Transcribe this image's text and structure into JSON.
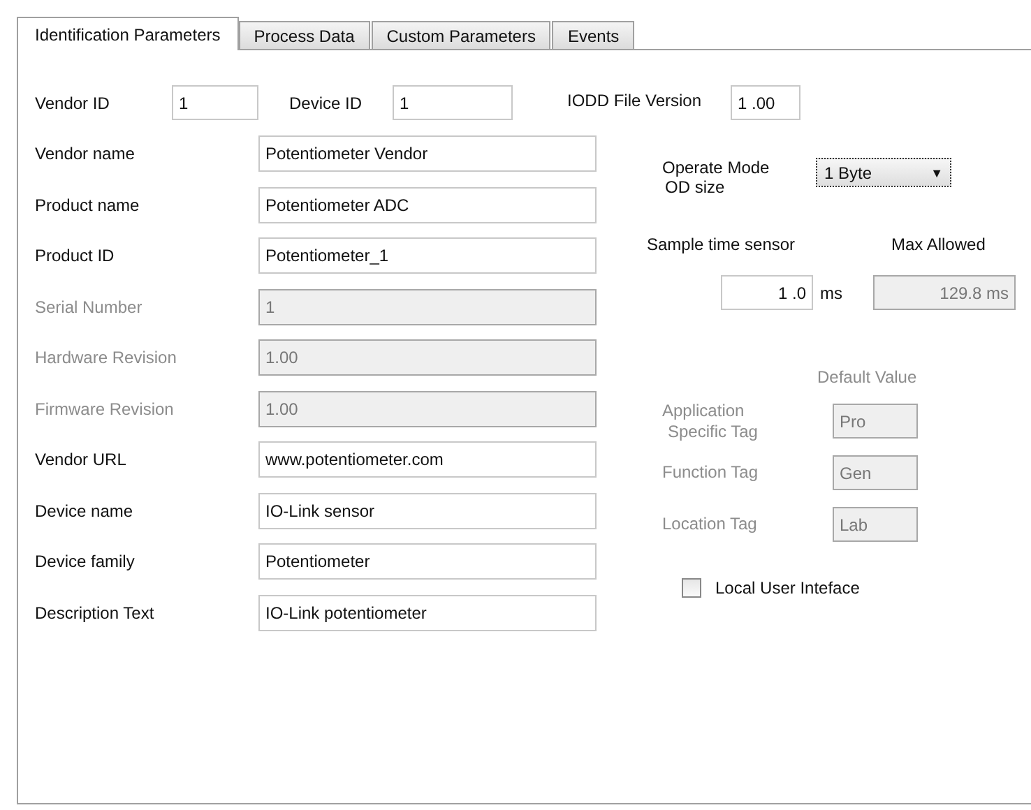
{
  "tabs": [
    {
      "label": "Identification Parameters",
      "selected": true
    },
    {
      "label": "Process Data",
      "selected": false
    },
    {
      "label": "Custom Parameters",
      "selected": false
    },
    {
      "label": "Events",
      "selected": false
    }
  ],
  "top_fields": [
    {
      "label": "Vendor ID",
      "value": "1"
    },
    {
      "label": "Device ID",
      "value": "1"
    },
    {
      "label": "IODD File Version",
      "value": "1 .00"
    }
  ],
  "fields": [
    {
      "label": "Vendor name",
      "value": "Potentiometer Vendor",
      "disabled": false
    },
    {
      "label": "Product name",
      "value": "Potentiometer ADC",
      "disabled": false
    },
    {
      "label": "Product ID",
      "value": "Potentiometer_1",
      "disabled": false
    },
    {
      "label": "Serial Number",
      "value": "1",
      "disabled": true
    },
    {
      "label": "Hardware Revision",
      "value": "1.00",
      "disabled": true
    },
    {
      "label": "Firmware Revision",
      "value": "1.00",
      "disabled": true
    },
    {
      "label": "Vendor URL",
      "value": "www.potentiometer.com",
      "disabled": false
    },
    {
      "label": "Device name",
      "value": "IO-Link sensor",
      "disabled": false
    },
    {
      "label": "Device family",
      "value": "Potentiometer",
      "disabled": false
    },
    {
      "label": "Description Text",
      "value": "IO-Link potentiometer",
      "disabled": false
    }
  ],
  "operate_mode": {
    "label_lines": [
      "Operate Mode",
      "OD size"
    ],
    "value": "1 Byte",
    "arrow": "▼"
  },
  "sample_time": {
    "label": "Sample time sensor",
    "value": "1 .0",
    "unit": "ms"
  },
  "max_allowed": {
    "label": "Max Allowed",
    "value": "129.8 ms",
    "disabled": true
  },
  "default_value_header": "Default Value",
  "tags": [
    {
      "label_lines": [
        "Application",
        "Specific Tag"
      ],
      "value": "Pro",
      "disabled": true
    },
    {
      "label_lines": [
        "Function Tag"
      ],
      "value": "Gen",
      "disabled": true
    },
    {
      "label_lines": [
        "Location Tag"
      ],
      "value": "Lab",
      "disabled": true
    }
  ],
  "local_ui": {
    "label": "Local User Inteface",
    "checked": false
  }
}
